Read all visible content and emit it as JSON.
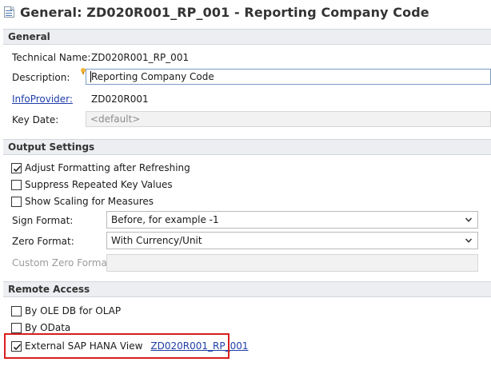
{
  "title": {
    "icon": "document-icon",
    "text": "General: ZD020R001_RP_001 - Reporting Company Code"
  },
  "general": {
    "header": "General",
    "technical_name_label": "Technical Name:",
    "technical_name_value": "ZD020R001_RP_001",
    "description_label": "Description:",
    "description_value": "Reporting Company Code",
    "infoprovider_label": "InfoProvider:",
    "infoprovider_value": "ZD020R001",
    "key_date_label": "Key Date:",
    "key_date_value": "<default>"
  },
  "output": {
    "header": "Output Settings",
    "adjust_formatting": {
      "label": "Adjust Formatting after Refreshing",
      "checked": true
    },
    "suppress_repeated": {
      "label": "Suppress Repeated Key Values",
      "checked": false
    },
    "show_scaling": {
      "label": "Show Scaling for Measures",
      "checked": false
    },
    "sign_format_label": "Sign Format:",
    "sign_format_value": "Before, for example -1",
    "zero_format_label": "Zero Format:",
    "zero_format_value": "With Currency/Unit",
    "custom_zero_format_label": "Custom Zero Format:",
    "custom_zero_format_value": ""
  },
  "remote": {
    "header": "Remote Access",
    "ole_db": {
      "label": "By OLE DB for OLAP",
      "checked": false
    },
    "odata": {
      "label": "By OData",
      "checked": false
    },
    "hana_view": {
      "label": "External SAP HANA View",
      "checked": true,
      "link": "ZD020R001_RP_001"
    }
  },
  "colors": {
    "highlight": "#d81e1e",
    "link": "#1f3fa8",
    "section_bg": "#eceef1"
  }
}
